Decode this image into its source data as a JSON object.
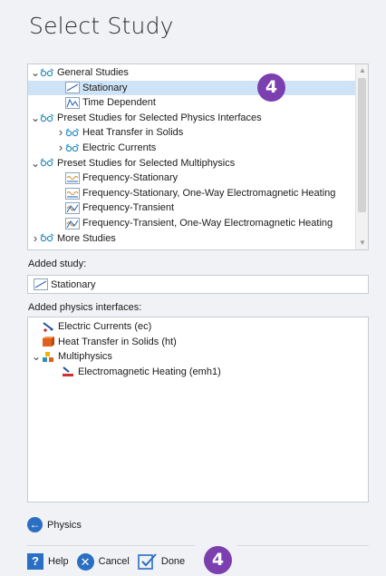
{
  "title": "Select Study",
  "tree": {
    "rows": [
      {
        "label": "General Studies",
        "level": 0,
        "arrow": "down",
        "icon": "study-group-icon"
      },
      {
        "label": "Stationary",
        "level": 1,
        "arrow": "",
        "icon": "stationary-study-icon",
        "selected": true
      },
      {
        "label": "Time Dependent",
        "level": 1,
        "arrow": "",
        "icon": "time-dependent-study-icon"
      },
      {
        "label": "Preset Studies for Selected Physics Interfaces",
        "level": 0,
        "arrow": "down",
        "icon": "study-group-icon"
      },
      {
        "label": "Heat Transfer in Solids",
        "level": 1,
        "arrow": "right",
        "icon": "study-group-icon"
      },
      {
        "label": "Electric Currents",
        "level": 1,
        "arrow": "right",
        "icon": "study-group-icon"
      },
      {
        "label": "Preset Studies for Selected Multiphysics",
        "level": 0,
        "arrow": "down",
        "icon": "study-group-icon"
      },
      {
        "label": "Frequency-Stationary",
        "level": 1,
        "arrow": "",
        "icon": "frequency-stationary-icon"
      },
      {
        "label": "Frequency-Stationary, One-Way Electromagnetic Heating",
        "level": 1,
        "arrow": "",
        "icon": "frequency-stationary-icon"
      },
      {
        "label": "Frequency-Transient",
        "level": 1,
        "arrow": "",
        "icon": "frequency-transient-icon"
      },
      {
        "label": "Frequency-Transient, One-Way Electromagnetic Heating",
        "level": 1,
        "arrow": "",
        "icon": "frequency-transient-icon"
      },
      {
        "label": "More Studies",
        "level": 0,
        "arrow": "right",
        "icon": "study-group-icon"
      }
    ]
  },
  "added_study": {
    "label": "Added study:",
    "value": "Stationary"
  },
  "added_physics": {
    "label": "Added physics interfaces:",
    "items": [
      {
        "label": "Electric Currents (ec)",
        "level": 0,
        "arrow": "",
        "icon": "electric-currents-icon"
      },
      {
        "label": "Heat Transfer in Solids (ht)",
        "level": 0,
        "arrow": "",
        "icon": "heat-transfer-icon"
      },
      {
        "label": "Multiphysics",
        "level": 0,
        "arrow": "down",
        "icon": "multiphysics-icon"
      },
      {
        "label": "Electromagnetic Heating (emh1)",
        "level": 1,
        "arrow": "",
        "icon": "electromagnetic-heating-icon"
      }
    ]
  },
  "badges": {
    "tree": "4",
    "footer": "4"
  },
  "nav": {
    "back_label": "Physics"
  },
  "footer": {
    "help": "Help",
    "cancel": "Cancel",
    "done": "Done"
  },
  "colors": {
    "accent": "#2b6fc4",
    "badge": "#7b3fb0",
    "selection": "#cfe3f7"
  }
}
